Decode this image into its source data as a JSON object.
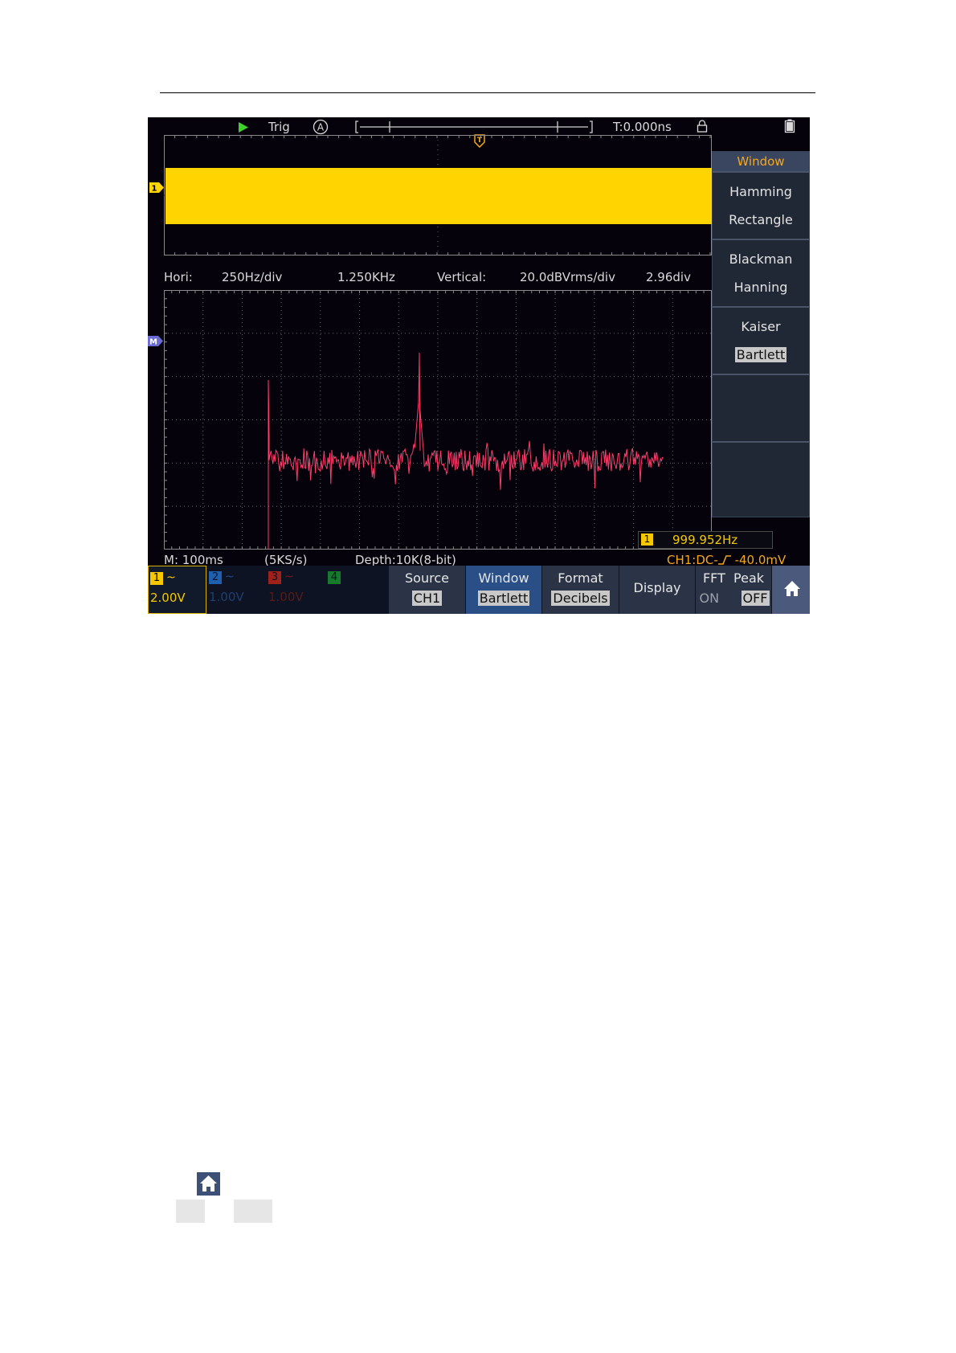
{
  "status_bar": {
    "trig_label": "Trig",
    "mode_icon": "A",
    "time_offset": "T:0.000ns"
  },
  "fft_info": {
    "hori_label": "Hori:",
    "hori_scale": "250Hz/div",
    "hori_center": "1.250KHz",
    "vert_label": "Vertical:",
    "vert_scale": "20.0dBVrms/div",
    "vert_pos": "2.96div"
  },
  "channel_markers": {
    "ch1": "1",
    "math": "M"
  },
  "freq_counter": {
    "channel": "1",
    "value": "999.952Hz"
  },
  "bottom_info": {
    "timebase": "M: 100ms",
    "sample_rate": "(5KS/s)",
    "depth": "Depth:10K(8-bit)",
    "trigger": "CH1:DC-",
    "trigger_level": "-40.0mV"
  },
  "window_menu": {
    "title": "Window",
    "options": [
      "Hamming",
      "Rectangle",
      "Blackman",
      "Hanning",
      "Kaiser",
      "Bartlett"
    ],
    "selected": "Bartlett"
  },
  "channels": [
    {
      "num": "1",
      "coupling": "~",
      "volts": "2.00V",
      "color": "#f5c800"
    },
    {
      "num": "2",
      "coupling": "~",
      "volts": "1.00V",
      "color": "#1f6fd0"
    },
    {
      "num": "3",
      "coupling": "~",
      "volts": "1.00V",
      "color": "#c0251c"
    },
    {
      "num": "4",
      "coupling": "",
      "volts": "",
      "color": "#1f9e3a"
    }
  ],
  "softkeys": {
    "source_label": "Source",
    "source_value": "CH1",
    "window_label": "Window",
    "window_value": "Bartlett",
    "format_label": "Format",
    "format_value": "Decibels",
    "display_label": "Display",
    "fft_peak_label": "FFT  Peak",
    "fft_peak_on": "ON",
    "fft_peak_off": "OFF"
  },
  "colors": {
    "ch1_trace": "#ffd400",
    "math_trace": "#ff3d6a",
    "grid": "#5a5a5a",
    "accent_orange": "#f5a81c",
    "softkey_bg": "#2b3446",
    "softkey_active_bg": "#2a4f87"
  },
  "icons": [
    "run-icon",
    "auto-mode-icon",
    "lock-icon",
    "battery-icon",
    "home-icon",
    "trigger-marker-icon"
  ]
}
